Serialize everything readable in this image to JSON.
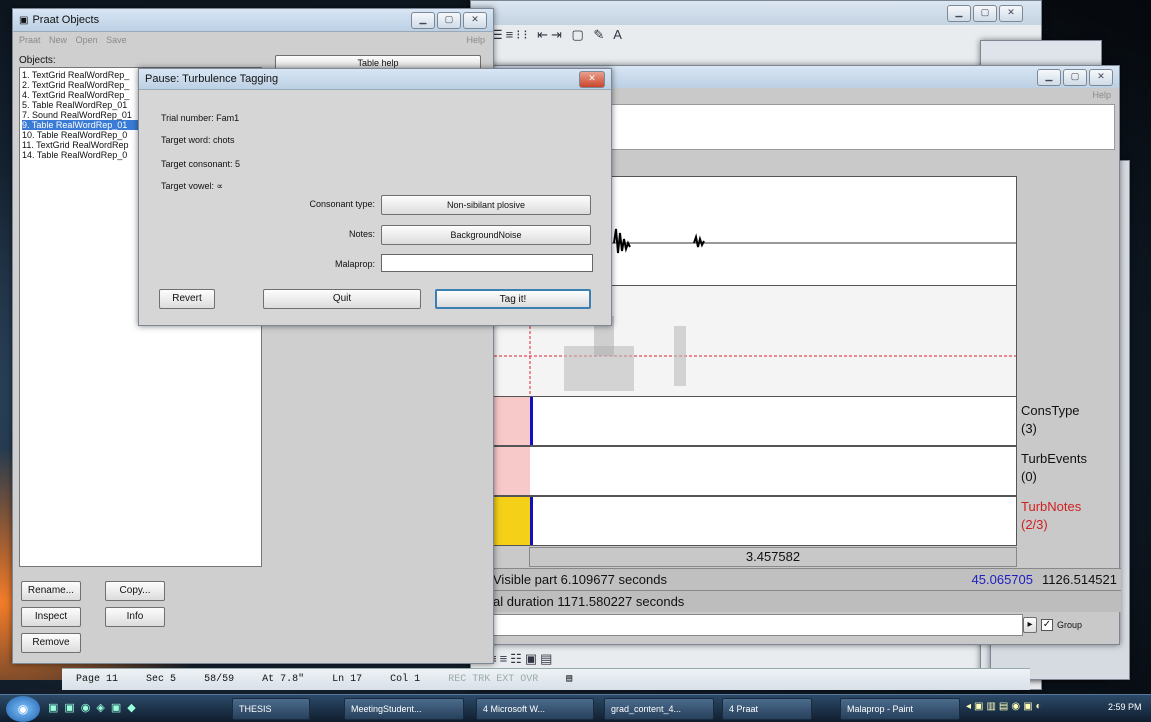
{
  "praat_objects": {
    "title": "Praat Objects",
    "menu": [
      "Praat",
      "New",
      "Open",
      "Save"
    ],
    "menu_help": "Help",
    "objects_label": "Objects:",
    "table_help": "Table help",
    "items": [
      "1. TextGrid RealWordRep_",
      "2. TextGrid RealWordRep_",
      "4. TextGrid RealWordRep_",
      "5. Table RealWordRep_01",
      "7. Sound RealWordRep_01",
      "9. Table RealWordRep_01",
      "10. Table RealWordRep_0",
      "11. TextGrid RealWordRep",
      "14. Table RealWordRep_0"
    ],
    "selected_index": 5,
    "buttons": {
      "rename": "Rename...",
      "copy": "Copy...",
      "inspect": "Inspect",
      "info": "Info",
      "remove": "Remove"
    }
  },
  "dialog": {
    "title": "Pause: Turbulence Tagging",
    "trial": "Trial number: Fam1",
    "target_word": "Target word: chots",
    "target_consonant": "Target consonant: 5",
    "target_vowel": "Target vowel: ∝",
    "consonant_type_label": "Consonant type:",
    "consonant_type_value": "Non-sibilant plosive",
    "notes_label": "Notes:",
    "notes_value": "BackgroundNoise",
    "malaprop_label": "Malaprop:",
    "malaprop_value": "",
    "revert": "Revert",
    "quit": "Quit",
    "tag": "Tag it!"
  },
  "editor": {
    "menu_help": "Help",
    "tiers": [
      {
        "name": "ConsType",
        "count": "(3)"
      },
      {
        "name": "TurbEvents",
        "count": "(0)"
      },
      {
        "name": "TurbNotes",
        "count": "(2/3)"
      }
    ],
    "cursor_time": "3.457582",
    "visible_part": "Visible part 6.109677 seconds",
    "window_start": "45.065705",
    "window_end": "1126.514521",
    "total_duration": "al duration 1171.580227 seconds",
    "group_label": "Group",
    "colors": {
      "pink": "#f8c9c9",
      "yellow": "#f4d018",
      "cursor_blue": "#1010c0",
      "tier_red": "#d02020",
      "link_blue": "#2020c0"
    }
  },
  "word": {
    "status": [
      "Page 11",
      "Sec 5",
      "58/59",
      "At 7.8\"",
      "Ln 17",
      "Col 1"
    ],
    "modes": "REC TRK EXT OVR"
  },
  "taskbar": {
    "items": [
      "THESIS",
      "MeetingStudent...",
      "4 Microsoft W...",
      "grad_content_4...",
      "4 Praat",
      "Malaprop - Paint"
    ],
    "clock": "2:59 PM"
  }
}
